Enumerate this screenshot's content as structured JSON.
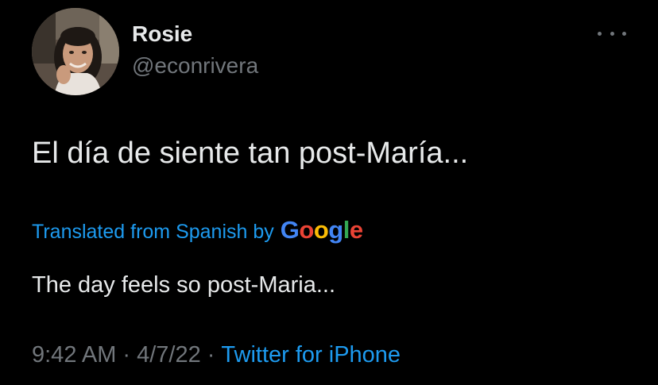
{
  "author": {
    "display_name": "Rosie",
    "handle": "@econrivera",
    "avatar_icon": "profile-photo"
  },
  "menu": {
    "icon": "more-options-icon"
  },
  "tweet": {
    "text": "El día de siente tan post-María..."
  },
  "translation": {
    "label": "Translated from Spanish by",
    "provider_letters": [
      "G",
      "o",
      "o",
      "g",
      "l",
      "e"
    ],
    "provider_colors": [
      "#4285F4",
      "#EA4335",
      "#FBBC05",
      "#4285F4",
      "#34A853",
      "#EA4335"
    ],
    "text": "The day feels so post-Maria..."
  },
  "meta": {
    "time": "9:42 AM",
    "separator": "·",
    "date": "4/7/22",
    "source": "Twitter for iPhone"
  },
  "colors": {
    "background": "#000000",
    "primary_text": "#e7e9ea",
    "secondary_text": "#71767b",
    "link": "#1d9bf0"
  }
}
